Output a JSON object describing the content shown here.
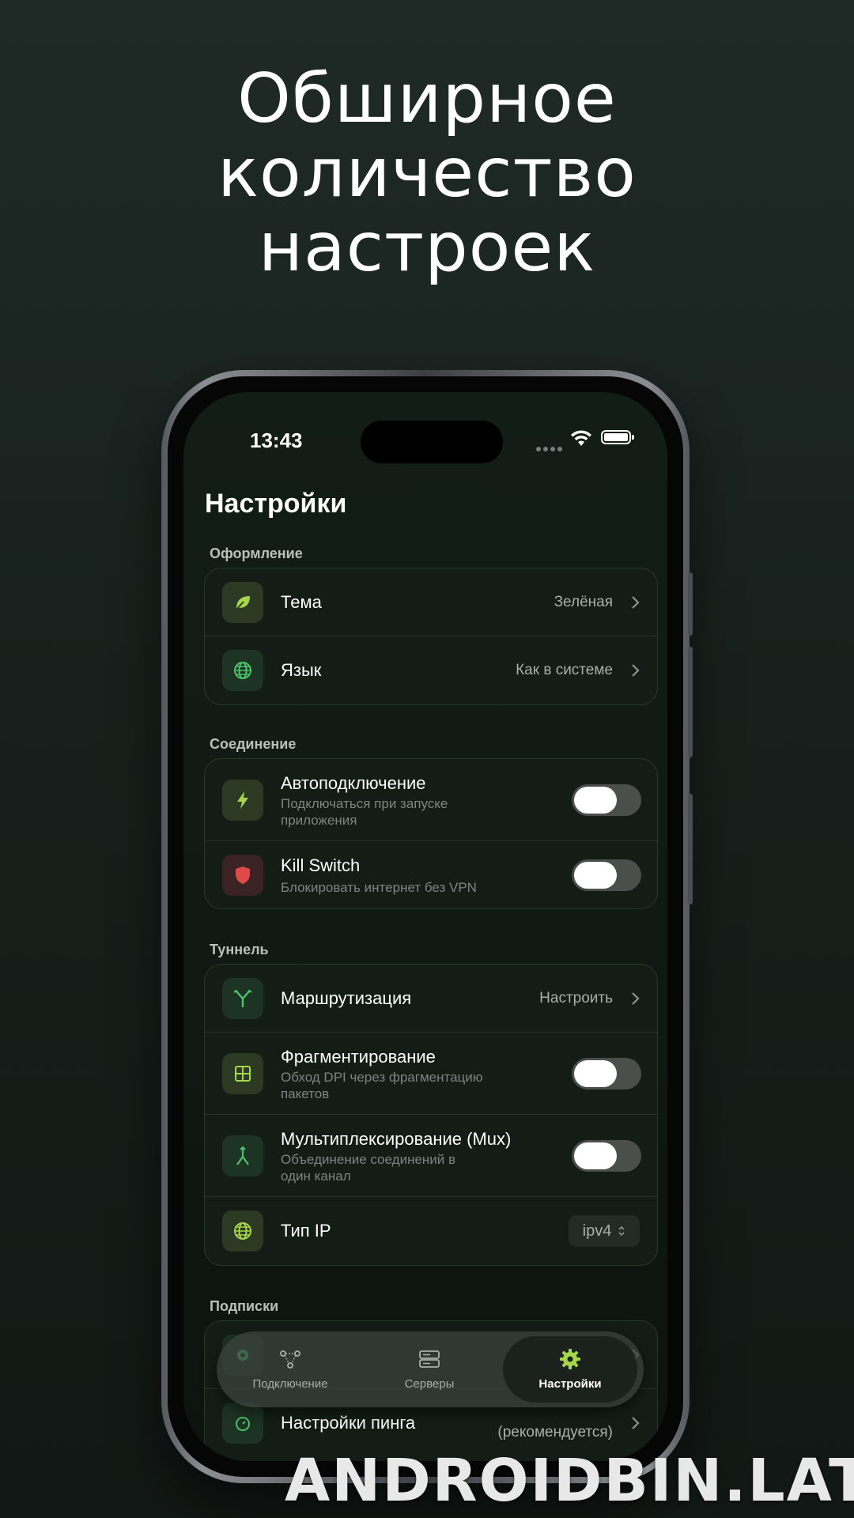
{
  "headline": [
    "Обширное",
    "количество",
    "настроек"
  ],
  "status_bar": {
    "time": "13:43"
  },
  "settings": {
    "title": "Настройки",
    "sections": {
      "appearance": {
        "label": "Оформление",
        "theme": {
          "title": "Тема",
          "value": "Зелёная"
        },
        "language": {
          "title": "Язык",
          "value": "Как в системе"
        }
      },
      "connection": {
        "label": "Соединение",
        "autoconnect": {
          "title": "Автоподключение",
          "subtitle": "Подключаться при запуске приложения",
          "enabled": false
        },
        "killswitch": {
          "title": "Kill Switch",
          "subtitle": "Блокировать интернет без VPN",
          "enabled": false
        }
      },
      "tunnel": {
        "label": "Туннель",
        "routing": {
          "title": "Маршрутизация",
          "value": "Настроить"
        },
        "fragmentation": {
          "title": "Фрагментирование",
          "subtitle": "Обход DPI через фрагментацию пакетов",
          "enabled": false
        },
        "mux": {
          "title": "Мультиплексирование (Mux)",
          "subtitle": "Объединение соединений в один канал",
          "enabled": false
        },
        "ip_type": {
          "title": "Тип IP",
          "value": "ipv4"
        }
      },
      "subscriptions": {
        "label": "Подписки",
        "ping": {
          "title": "Настройки пинга",
          "value": "(рекомендуется)"
        }
      }
    }
  },
  "tabbar": {
    "tabs": [
      {
        "label": "Подключение",
        "icon": "connection-icon"
      },
      {
        "label": "Серверы",
        "icon": "servers-icon"
      },
      {
        "label": "Настройки",
        "icon": "gear-icon",
        "active": true
      }
    ]
  },
  "watermark": "ANDROIDBIN.LAT",
  "colors": {
    "accent": "#a6d64a",
    "background": "#17201c",
    "danger": "#e0494a"
  }
}
